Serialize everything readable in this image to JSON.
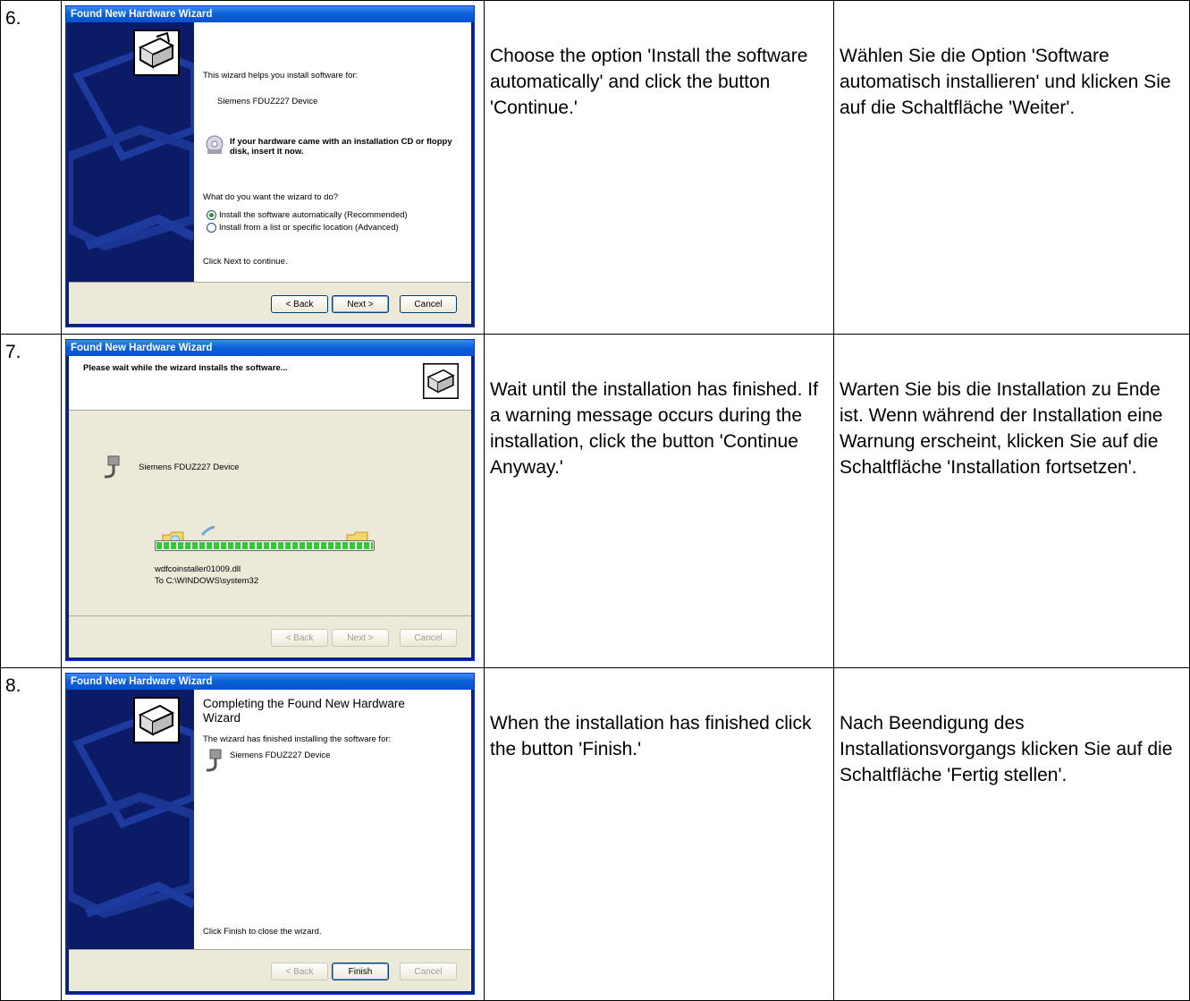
{
  "steps": [
    {
      "num": "6.",
      "window_title": "Found New Hardware Wizard",
      "text_en": "Choose the option 'Install the software automatically' and click the button 'Continue.'",
      "text_de": "Wählen Sie die Option 'Software automatisch installieren' und klicken Sie auf die Schaltfläche 'Weiter'.",
      "intro": "This wizard helps you install software for:",
      "device": "Siemens FDUZ227 Device",
      "cd_hint": "If your hardware came with an installation CD or floppy disk, insert it now.",
      "question": "What do you want the wizard to do?",
      "option_auto": "Install the software automatically (Recommended)",
      "option_list": "Install from a list or specific location (Advanced)",
      "continue_hint": "Click Next to continue.",
      "back": "< Back",
      "next": "Next >",
      "cancel": "Cancel"
    },
    {
      "num": "7.",
      "window_title": "Found New Hardware Wizard",
      "text_en": "Wait until the installation has finished. If a warning message occurs during the installation, click the button 'Continue Anyway.'",
      "text_de": "Warten Sie bis die Installation zu Ende ist. Wenn während der Installation eine Warnung erscheint, klicken Sie auf die Schaltfläche 'Installation fortsetzen'.",
      "header": "Please wait while the wizard installs the software...",
      "device": "Siemens FDUZ227 Device",
      "file": "wdfcoinstaller01009.dll",
      "dest": "To C:\\WINDOWS\\system32",
      "progress": 1.0,
      "back": "< Back",
      "next": "Next >",
      "cancel": "Cancel"
    },
    {
      "num": "8.",
      "window_title": "Found New Hardware Wizard",
      "text_en": "When the installation has finished click the button 'Finish.'",
      "text_de": "Nach Beendigung des Installationsvorgangs klicken Sie auf die Schaltfläche 'Fertig stellen'.",
      "heading": "Completing the Found New Hardware Wizard",
      "finished": "The wizard has finished installing the software for:",
      "device": "Siemens FDUZ227 Device",
      "close_hint": "Click Finish to close the wizard.",
      "back": "< Back",
      "finish": "Finish",
      "cancel": "Cancel"
    }
  ]
}
